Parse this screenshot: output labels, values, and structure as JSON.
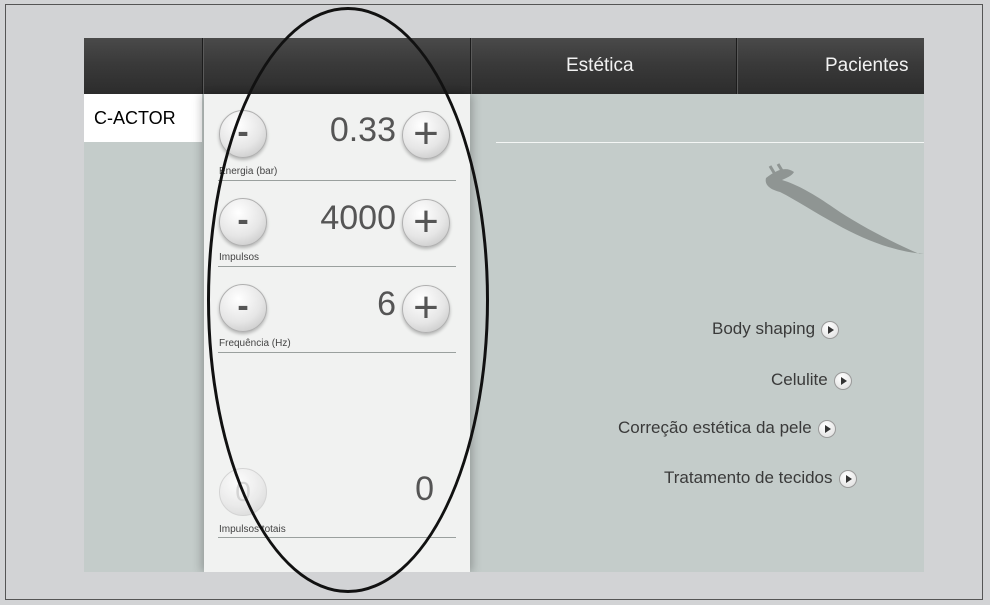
{
  "nav": {
    "tabs": [
      "",
      "Estética",
      "Pacientes"
    ]
  },
  "product_tab": "C-ACTOR",
  "controls": [
    {
      "label": "Energia (bar)",
      "value": "0.33",
      "minus": "-",
      "plus": "+"
    },
    {
      "label": "Impulsos",
      "value": "4000",
      "minus": "-",
      "plus": "+"
    },
    {
      "label": "Frequência (Hz)",
      "value": "6",
      "minus": "-",
      "plus": "+"
    }
  ],
  "total": {
    "label": "Impulsos totais",
    "value": "0",
    "reset_glyph": "0"
  },
  "treatments": [
    {
      "label": "Body shaping",
      "icon": "play-icon"
    },
    {
      "label": "Celulite",
      "icon": "play-icon"
    },
    {
      "label": "Correção estética da pele",
      "icon": "play-icon"
    },
    {
      "label": "Tratamento de tecidos",
      "icon": "play-icon"
    }
  ],
  "colors": {
    "navbar": "#2f2f2f",
    "panel": "#f1f2f1",
    "background": "#c4ccca",
    "annotation": "#111111"
  }
}
